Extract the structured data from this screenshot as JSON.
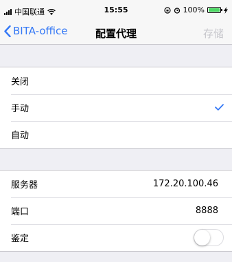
{
  "status_bar": {
    "carrier": "中国联通",
    "time": "15:55",
    "battery_percent": "100%",
    "battery_level": 1.0
  },
  "nav": {
    "back_label": "BITA-office",
    "title": "配置代理",
    "save_label": "存储"
  },
  "proxy_modes": {
    "options": [
      "关闭",
      "手动",
      "自动"
    ],
    "selected": "手动"
  },
  "manual_settings": {
    "server_label": "服务器",
    "server_value": "172.20.100.46",
    "port_label": "端口",
    "port_value": "8888",
    "auth_label": "鉴定",
    "auth_enabled": false
  },
  "colors": {
    "accent": "#3478f6",
    "disabled": "#c7c7cc",
    "battery": "#4cd964",
    "background": "#efeff4"
  }
}
